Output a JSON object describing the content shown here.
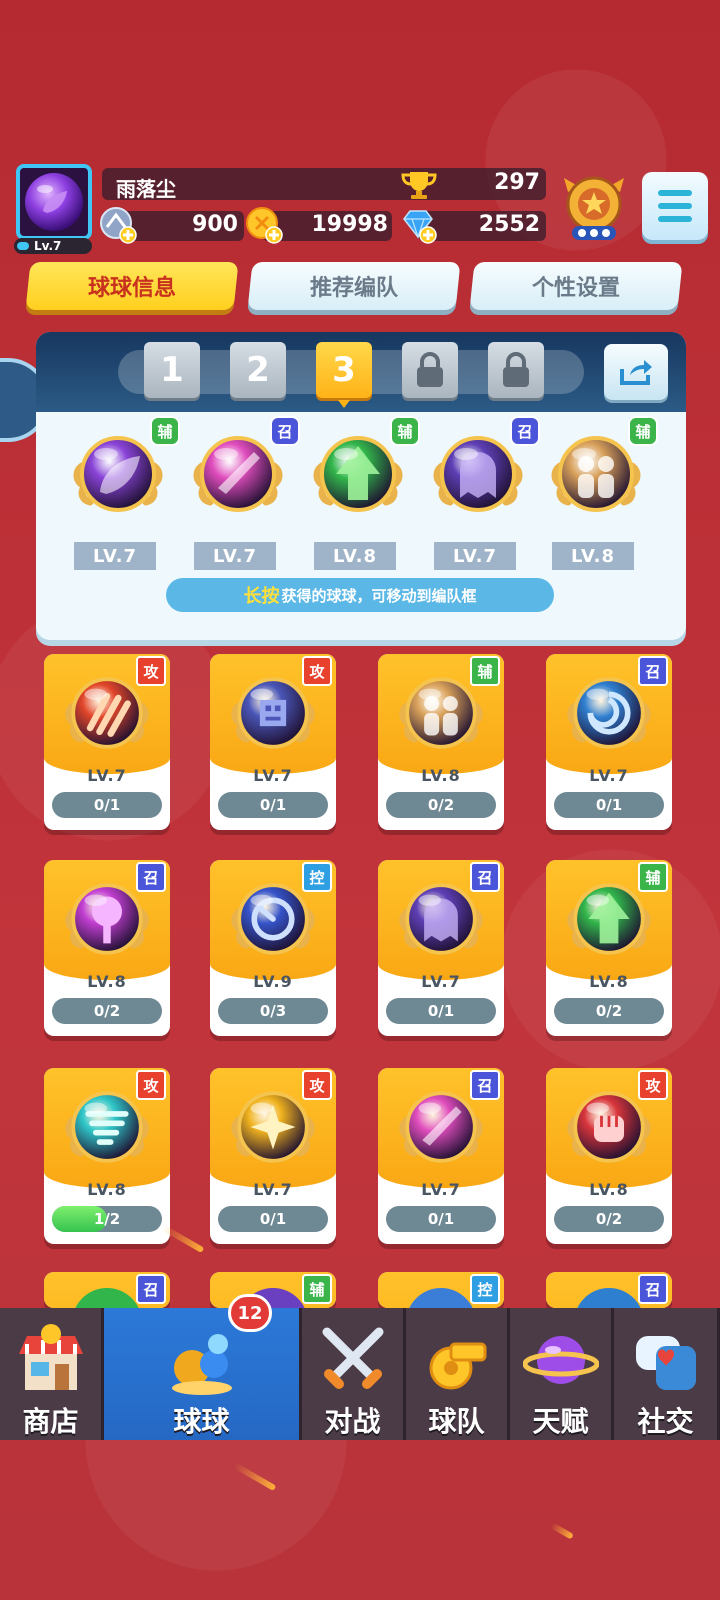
{
  "player": {
    "name": "雨落尘",
    "level": "Lv.7",
    "trophies": "297",
    "stamina": "900",
    "gold": "19998",
    "gems": "2552"
  },
  "tabs": [
    {
      "label": "球球信息",
      "active": true
    },
    {
      "label": "推荐编队",
      "active": false
    },
    {
      "label": "个性设置",
      "active": false
    }
  ],
  "lineup": {
    "slots": [
      "1",
      "2",
      "3"
    ],
    "selected_slot": "3",
    "locked_slots": 2,
    "members": [
      {
        "level": "LV.7",
        "role": "辅",
        "color": "#8a44d8",
        "icon": "leaf-icon"
      },
      {
        "level": "LV.7",
        "role": "召",
        "color": "#e04dbd",
        "icon": "blade-icon"
      },
      {
        "level": "LV.8",
        "role": "辅",
        "color": "#32b64b",
        "icon": "arrow-up-star-icon"
      },
      {
        "level": "LV.7",
        "role": "召",
        "color": "#5e3fb5",
        "icon": "ghost-icon"
      },
      {
        "level": "LV.8",
        "role": "辅",
        "color": "#d8a05a",
        "icon": "crowd-icon"
      }
    ],
    "hint_highlight": "长按",
    "hint_text": "获得的球球，可移动到编队框"
  },
  "roles": {
    "攻": "#e8422f",
    "辅": "#3bb54a",
    "召": "#4b55d9",
    "控": "#2f9fe3"
  },
  "cards": [
    {
      "level": "LV.7",
      "progress": "0/1",
      "fill": 0,
      "role": "攻",
      "color": "#e2462a",
      "icon": "claw-icon"
    },
    {
      "level": "LV.7",
      "progress": "0/1",
      "fill": 0,
      "role": "攻",
      "color": "#4a56b8",
      "icon": "pixel-icon"
    },
    {
      "level": "LV.8",
      "progress": "0/2",
      "fill": 0,
      "role": "辅",
      "color": "#d8a05a",
      "icon": "crowd-icon"
    },
    {
      "level": "LV.7",
      "progress": "0/1",
      "fill": 0,
      "role": "召",
      "color": "#2f7fd0",
      "icon": "swirl-icon"
    },
    {
      "level": "LV.8",
      "progress": "0/2",
      "fill": 0,
      "role": "召",
      "color": "#c23fd2",
      "icon": "tree-icon"
    },
    {
      "level": "LV.9",
      "progress": "0/3",
      "fill": 0,
      "role": "控",
      "color": "#3554c9",
      "icon": "clock-icon"
    },
    {
      "level": "LV.7",
      "progress": "0/1",
      "fill": 0,
      "role": "召",
      "color": "#5e3fb5",
      "icon": "ghost-icon"
    },
    {
      "level": "LV.8",
      "progress": "0/2",
      "fill": 0,
      "role": "辅",
      "color": "#32b64b",
      "icon": "arrow-up-star-icon"
    },
    {
      "level": "LV.8",
      "progress": "1/2",
      "fill": 0.5,
      "role": "攻",
      "color": "#2fc6c8",
      "icon": "tornado-icon"
    },
    {
      "level": "LV.7",
      "progress": "0/1",
      "fill": 0,
      "role": "攻",
      "color": "#f0b21e",
      "icon": "shuriken-icon"
    },
    {
      "level": "LV.7",
      "progress": "0/1",
      "fill": 0,
      "role": "召",
      "color": "#e04dbd",
      "icon": "blade-icon"
    },
    {
      "level": "LV.8",
      "progress": "0/2",
      "fill": 0,
      "role": "攻",
      "color": "#d8353b",
      "icon": "fist-icon"
    }
  ],
  "partial_cards": [
    {
      "role": "召",
      "color": "#32b64b"
    },
    {
      "role": "辅",
      "color": "#6a3fc0"
    },
    {
      "role": "控",
      "color": "#3a7ed8"
    },
    {
      "role": "召",
      "color": "#2f7fd0"
    }
  ],
  "nav": {
    "items": [
      {
        "label": "商店",
        "icon": "shop-icon",
        "active": false
      },
      {
        "label": "球球",
        "icon": "balls-icon",
        "active": true,
        "badge": "12"
      },
      {
        "label": "对战",
        "icon": "crossed-swords-icon",
        "active": false
      },
      {
        "label": "球队",
        "icon": "whistle-icon",
        "active": false
      },
      {
        "label": "天赋",
        "icon": "planet-icon",
        "active": false
      },
      {
        "label": "社交",
        "icon": "chat-heart-icon",
        "active": false
      }
    ]
  }
}
